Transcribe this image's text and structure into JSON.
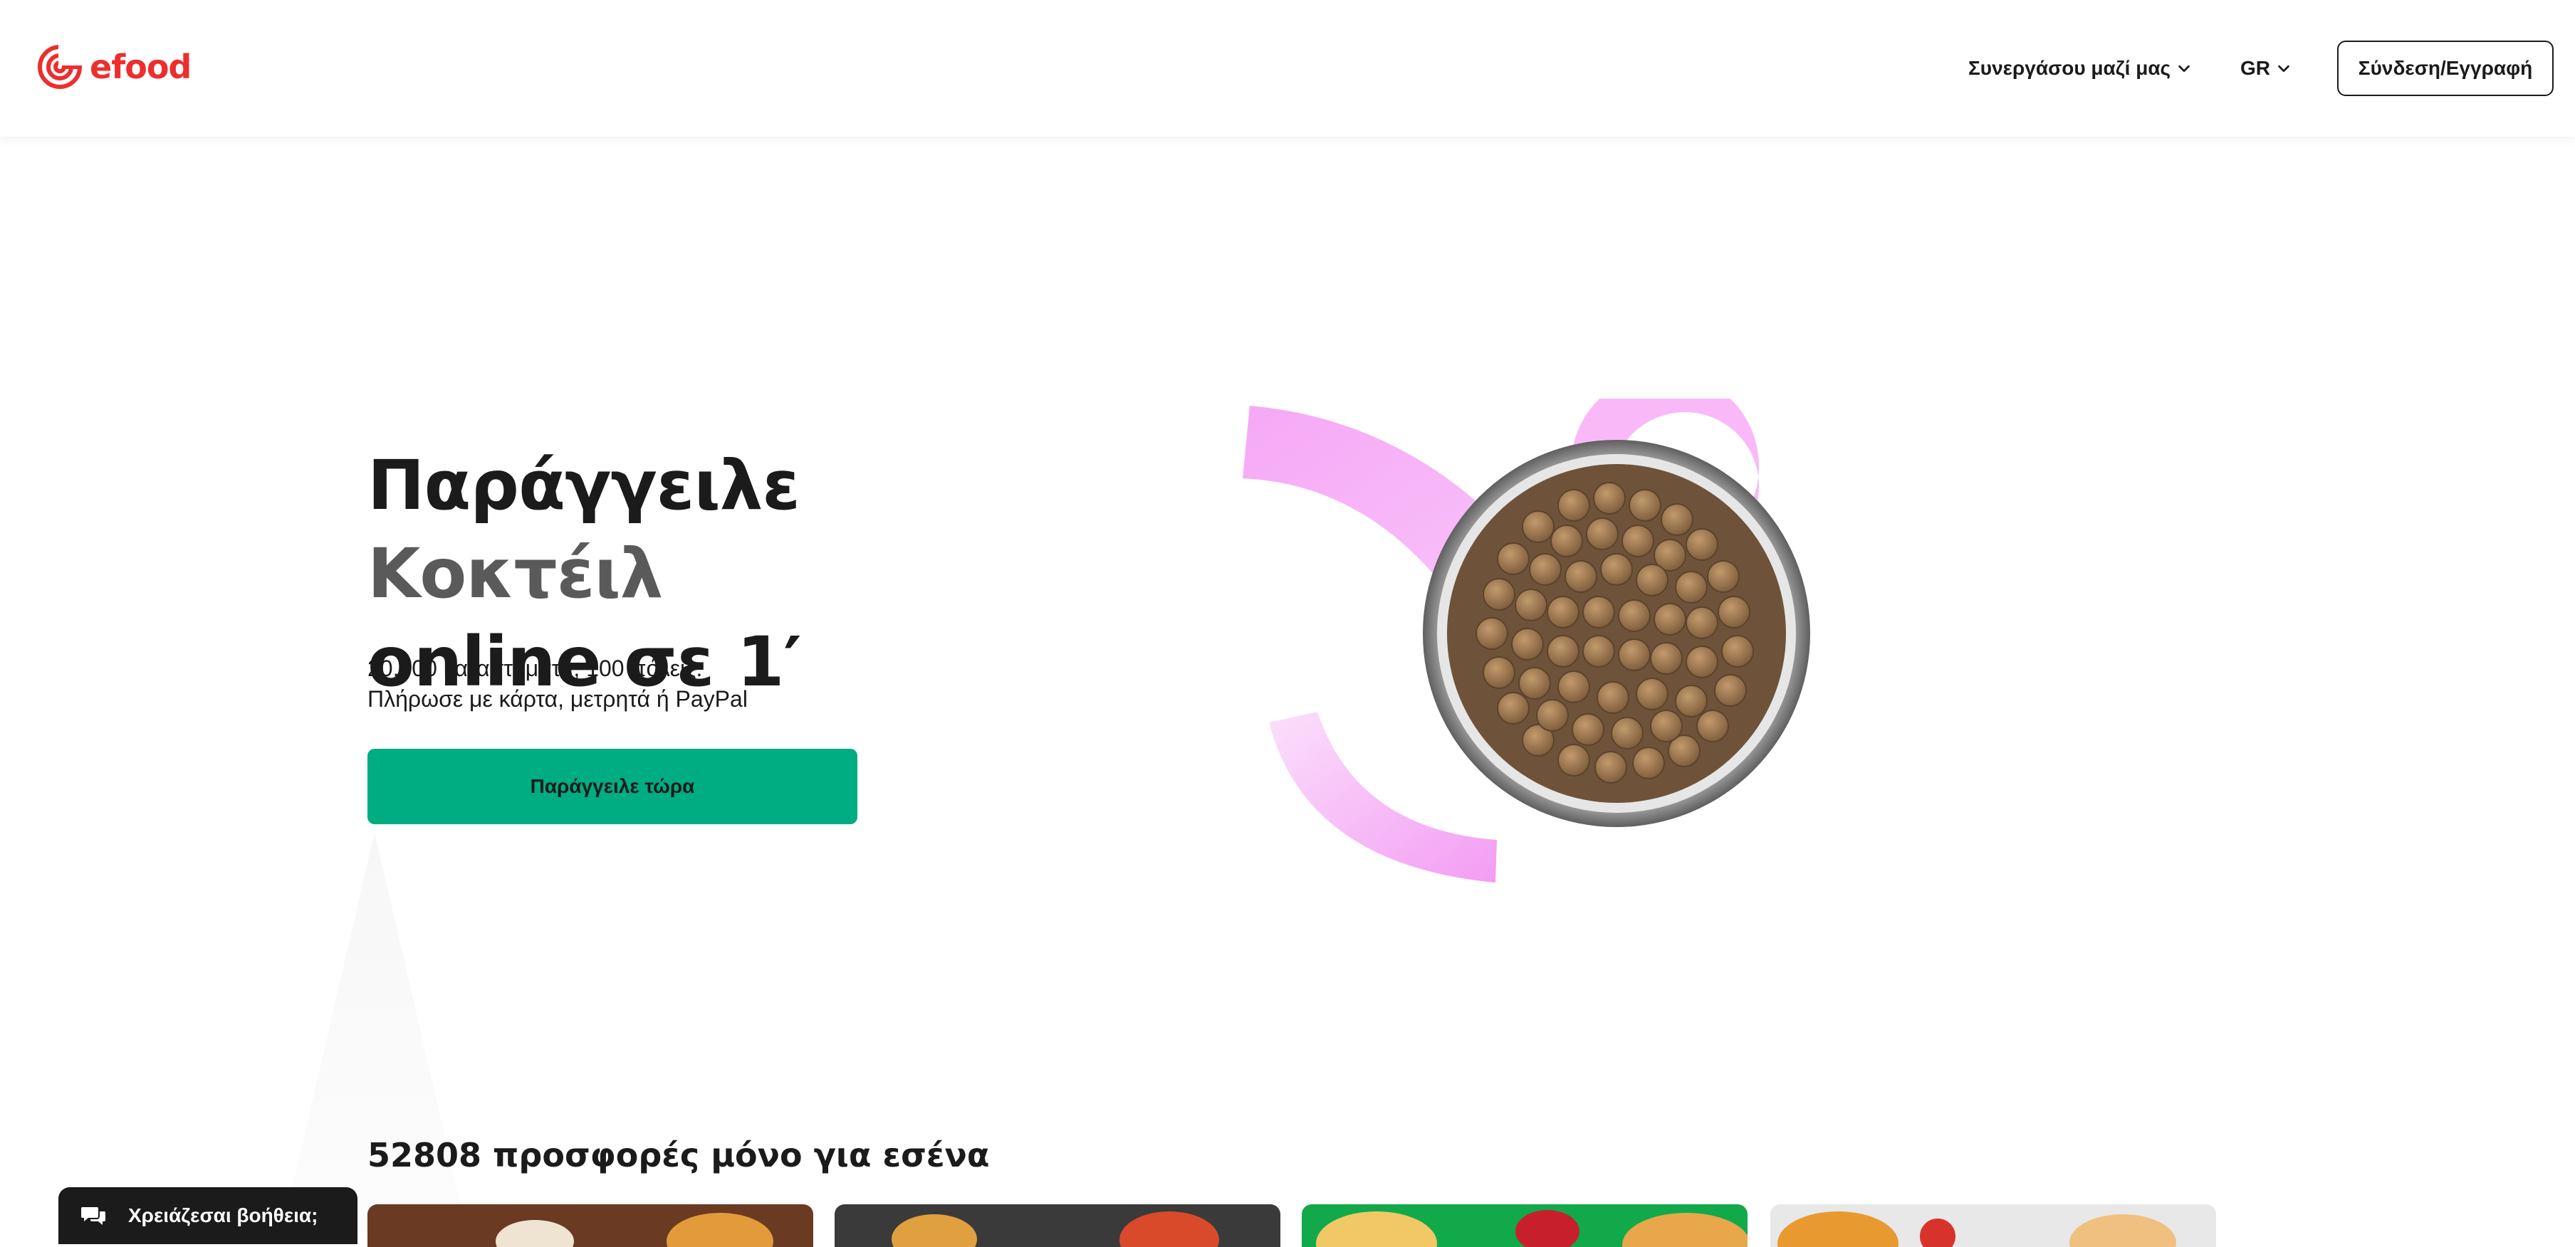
{
  "header": {
    "logo_text": "efood",
    "partner_label": "Συνεργάσου μαζί μας",
    "language_label": "GR",
    "login_label": "Σύνδεση/Εγγραφή",
    "brand_color": "#ed2e2e"
  },
  "hero": {
    "title_prefix": "Παράγγειλε ",
    "title_accent": "Κοκτέιλ",
    "title_suffix": "online σε 1′",
    "subtitle_line1": "20.000 καταστήματα, 100 πόλεις.",
    "subtitle_line2": "Πλήρωσε με κάρτα, μετρητά ή PayPal",
    "cta_label": "Παράγγειλε τώρα",
    "cta_color": "#00ac82",
    "accent_shape_color": "#f6a8f6",
    "image_subject": "bowl-of-pet-food"
  },
  "offers": {
    "title": "52808 προσφορές μόνο για εσένα",
    "card_count_visible": 4
  },
  "help": {
    "label": "Χρειάζεσαι βοήθεια;",
    "icon": "chat-bubbles-icon"
  }
}
